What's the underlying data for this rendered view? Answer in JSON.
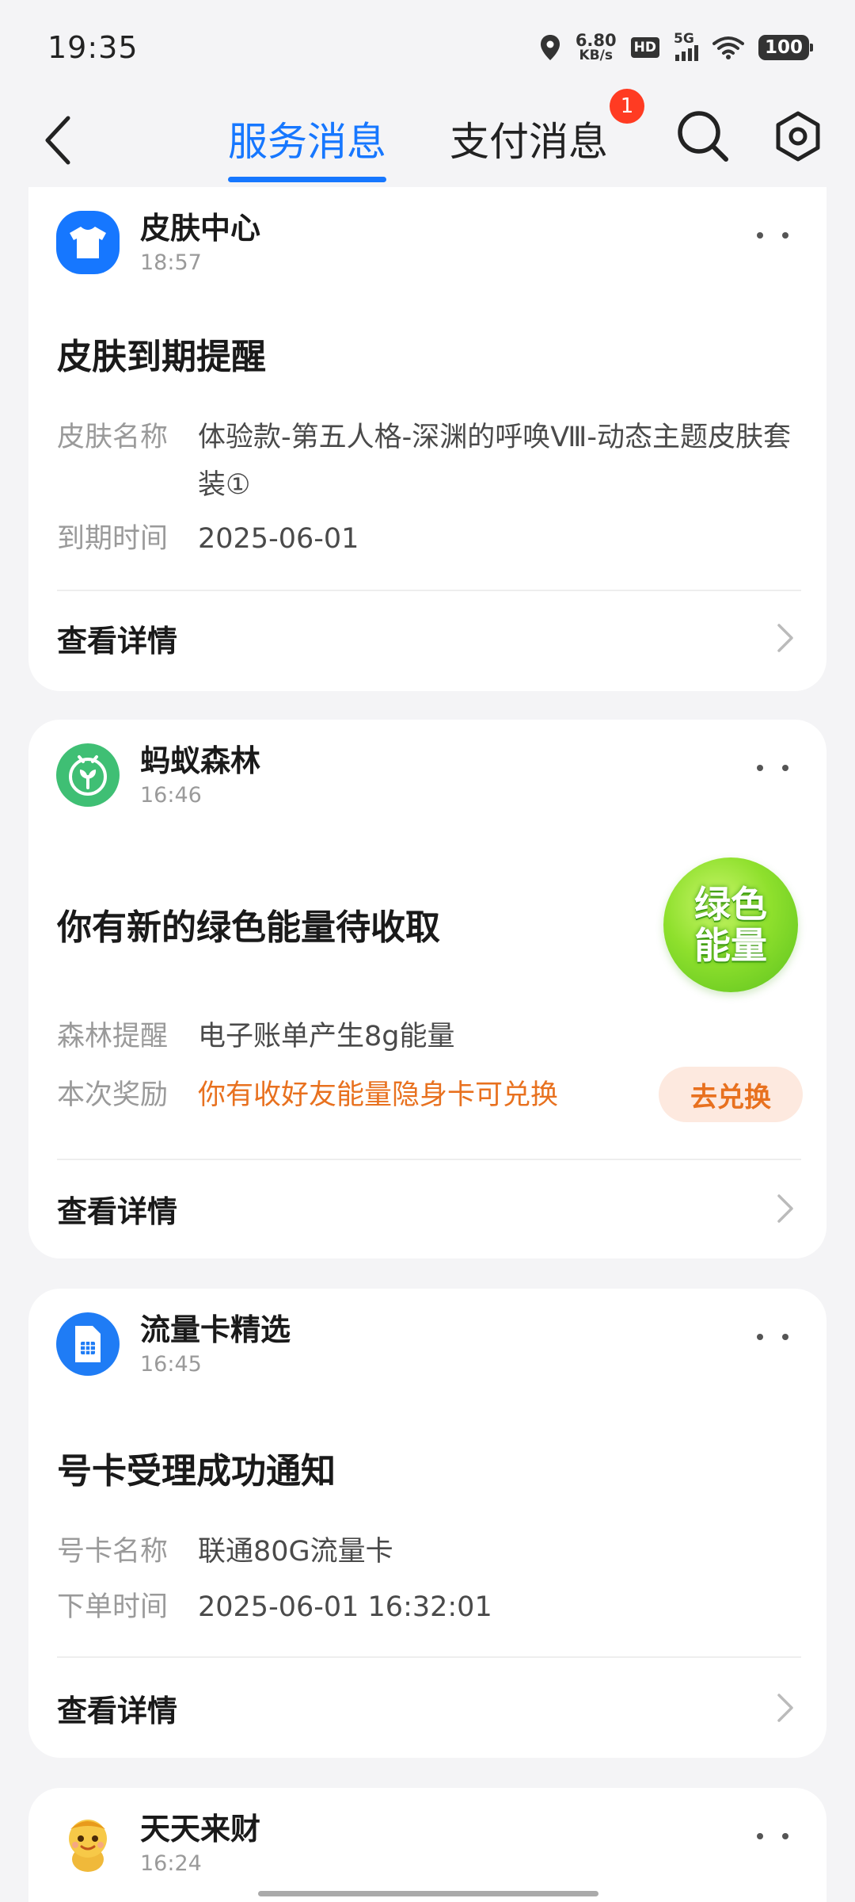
{
  "status_bar": {
    "time": "19:35",
    "net_speed_value": "6.80",
    "net_speed_unit": "KB/s",
    "hd_label": "HD",
    "network_label": "5G",
    "battery": "100"
  },
  "nav": {
    "tabs": [
      {
        "label": "服务消息",
        "active": true
      },
      {
        "label": "支付消息",
        "active": false,
        "badge": "1"
      }
    ],
    "accent_color": "#1677ff",
    "badge_color": "#ff3b22"
  },
  "cards": [
    {
      "app_name": "皮肤中心",
      "time": "18:57",
      "icon": "tshirt-icon",
      "title": "皮肤到期提醒",
      "fields": [
        {
          "label": "皮肤名称",
          "value": "体验款-第五人格-深渊的呼唤Ⅷ-动态主题皮肤套装①"
        },
        {
          "label": "到期时间",
          "value": "2025-06-01"
        }
      ],
      "detail_label": "查看详情"
    },
    {
      "app_name": "蚂蚁森林",
      "time": "16:46",
      "icon": "sprout-icon",
      "title": "你有新的绿色能量待收取",
      "energy_badge": "绿色能量",
      "fields": [
        {
          "label": "森林提醒",
          "value": "电子账单产生8g能量"
        },
        {
          "label": "本次奖励",
          "value": "你有收好友能量隐身卡可兑换"
        }
      ],
      "action_button": "去兑换",
      "detail_label": "查看详情"
    },
    {
      "app_name": "流量卡精选",
      "time": "16:45",
      "icon": "sim-card-icon",
      "title": "号卡受理成功通知",
      "fields": [
        {
          "label": "号卡名称",
          "value": "联通80G流量卡"
        },
        {
          "label": "下单时间",
          "value": "2025-06-01 16:32:01"
        }
      ],
      "detail_label": "查看详情"
    },
    {
      "app_name": "天天来财",
      "time": "16:24",
      "icon": "mascot-icon"
    }
  ]
}
